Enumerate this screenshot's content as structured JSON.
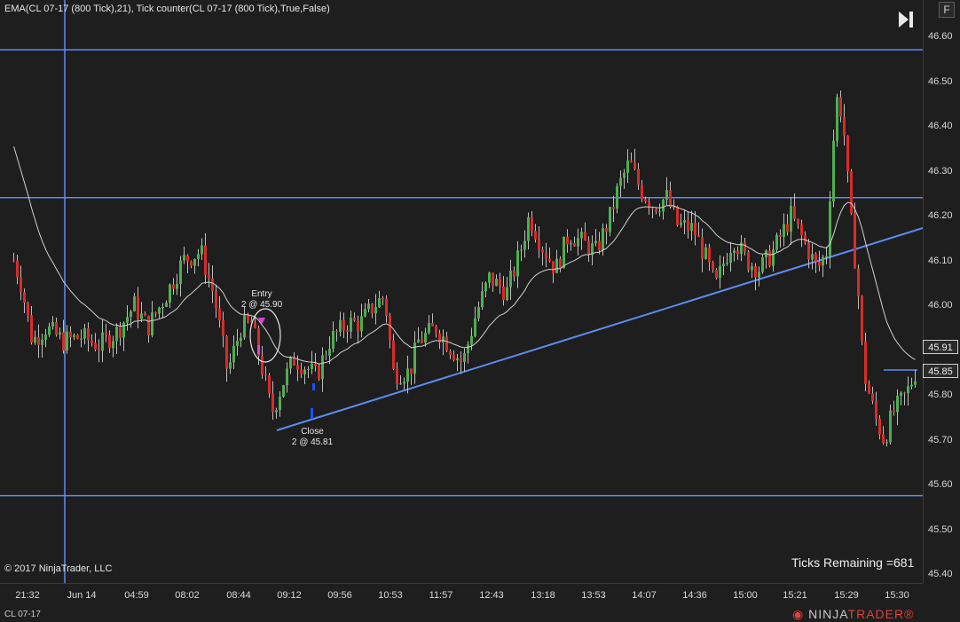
{
  "indicator_label": "EMA(CL 07-17 (800 Tick),21), Tick counter(CL 07-17 (800 Tick),True,False)",
  "copyright": "© 2017 NinjaTrader, LLC",
  "ticks_remaining": "Ticks Remaining =681",
  "instrument": "CL 07-17",
  "logo_text": "NINJA",
  "logo_text2": "TRADER®",
  "f_button": "F",
  "price_tag_ema": "45.91",
  "price_tag_last": "45.85",
  "entry_label": "Entry",
  "entry_detail": "2 @ 45.90",
  "close_label": "Close",
  "close_detail": "2 @ 45.81",
  "colors": {
    "background": "#1e1e1e",
    "up": "#4caf50",
    "down": "#d92b2b",
    "line": "#5b8def",
    "ema": "#d0d0d0"
  },
  "chart_data": {
    "type": "candlestick",
    "y_ticks": [
      "46.60",
      "46.50",
      "46.40",
      "46.30",
      "46.20",
      "46.10",
      "46.00",
      "45.90",
      "45.80",
      "45.70",
      "45.60",
      "45.50",
      "45.40"
    ],
    "ylim": [
      45.39,
      46.64
    ],
    "x_ticks": [
      "21:32",
      "Jun 14",
      "04:59",
      "08:02",
      "08:44",
      "09:12",
      "09:56",
      "10:53",
      "11:57",
      "12:43",
      "13:18",
      "13:53",
      "14:07",
      "14:36",
      "15:00",
      "15:21",
      "15:29",
      "15:30"
    ],
    "horizontal_lines": [
      46.57,
      46.24,
      45.575
    ],
    "last_price": 45.85,
    "ema_last": 45.91
  }
}
